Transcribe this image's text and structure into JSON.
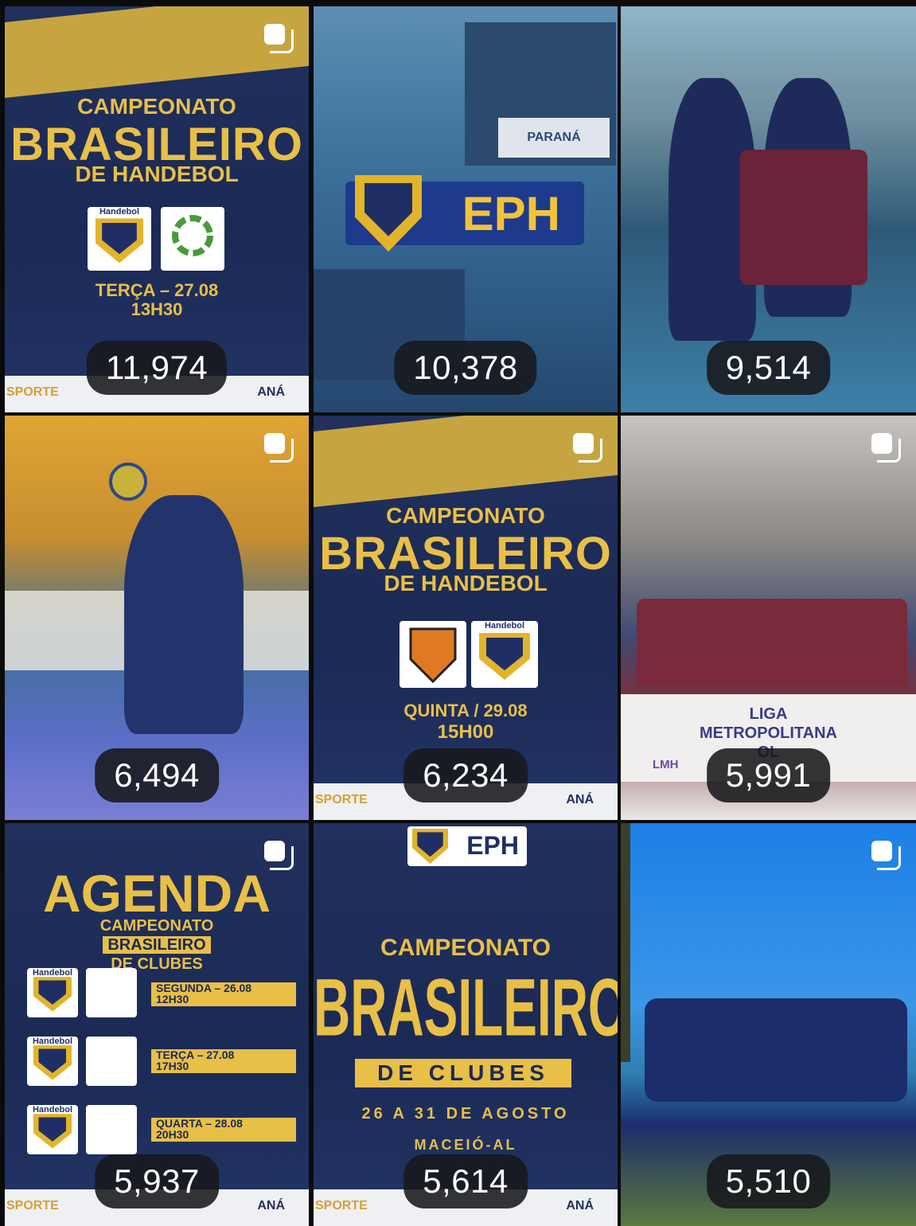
{
  "grid": {
    "tiles": [
      {
        "views": "11,974",
        "carousel": true,
        "poster": {
          "line1": "CAMPEONATO",
          "line2": "BRASILEIRO",
          "line3": "DE HANDEBOL",
          "logo_label": "Handebol",
          "date": "TERÇA – 27.08",
          "time": "13H30",
          "footer_left": "SPORTE",
          "footer_right": "ANÁ"
        }
      },
      {
        "views": "10,378",
        "carousel": false,
        "poster": {
          "brand": "EPH",
          "banner": "PARANÁ"
        }
      },
      {
        "views": "9,514",
        "carousel": false
      },
      {
        "views": "6,494",
        "carousel": true
      },
      {
        "views": "6,234",
        "carousel": true,
        "poster": {
          "line1": "CAMPEONATO",
          "line2": "BRASILEIRO",
          "line3": "DE HANDEBOL",
          "logo_label": "Handebol",
          "date": "QUINTA / 29.08",
          "time": "15H00",
          "footer_left": "SPORTE",
          "footer_right": "ANÁ"
        }
      },
      {
        "views": "5,991",
        "carousel": true,
        "poster": {
          "banner1": "LIGA",
          "banner2": "METROPOLITANA",
          "banner3": "OL",
          "mark": "LMH"
        }
      },
      {
        "views": "5,937",
        "carousel": true,
        "poster": {
          "title": "AGENDA",
          "line1": "CAMPEONATO",
          "line2": "BRASILEIRO",
          "line3": "DE CLUBES",
          "logo_label": "Handebol",
          "games": [
            {
              "day": "SEGUNDA – 26.08",
              "time": "12H30"
            },
            {
              "day": "TERÇA – 27.08",
              "time": "17H30"
            },
            {
              "day": "QUARTA – 28.08",
              "time": "20H30"
            }
          ],
          "footer_left": "SPORTE",
          "footer_right": "ANÁ"
        }
      },
      {
        "views": "5,614",
        "carousel": false,
        "poster": {
          "brand": "EPH",
          "line1": "CAMPEONATO",
          "line2": "BRASILEIRO",
          "line3": "DE CLUBES",
          "dates": "26 A 31 DE AGOSTO",
          "place": "MACEIÓ-AL",
          "footer_left": "SPORTE",
          "footer_right": "ANÁ"
        }
      },
      {
        "views": "5,510",
        "carousel": true
      }
    ]
  },
  "colors": {
    "accent_gold": "#e8bf47",
    "poster_navy": "#1b2a55",
    "badge_bg": "#18181b"
  }
}
